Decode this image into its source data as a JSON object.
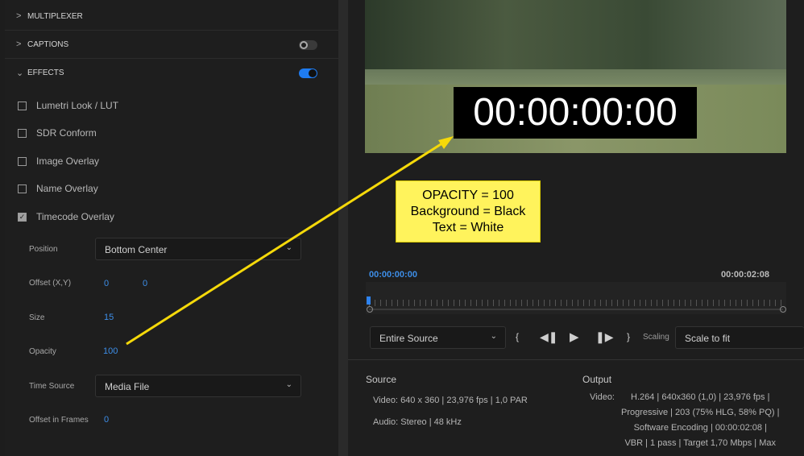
{
  "left": {
    "sections": [
      {
        "label": "MULTIPLEXER"
      },
      {
        "label": "CAPTIONS",
        "toggle": false
      },
      {
        "label": "EFFECTS",
        "toggle": true
      }
    ],
    "effects": [
      {
        "label": "Lumetri Look / LUT",
        "checked": false
      },
      {
        "label": "SDR Conform",
        "checked": false
      },
      {
        "label": "Image Overlay",
        "checked": false
      },
      {
        "label": "Name Overlay",
        "checked": false
      },
      {
        "label": "Timecode Overlay",
        "checked": true
      }
    ],
    "position": {
      "label": "Position",
      "value": "Bottom Center"
    },
    "offset": {
      "label": "Offset (X,Y)",
      "x": "0",
      "y": "0"
    },
    "size": {
      "label": "Size",
      "value": "15"
    },
    "opacity": {
      "label": "Opacity",
      "value": "100"
    },
    "time_source": {
      "label": "Time Source",
      "value": "Media File"
    },
    "offset_frames": {
      "label": "Offset in Frames",
      "value": "0"
    }
  },
  "preview": {
    "timecode": "00:00:00:00"
  },
  "annotation": {
    "lines": [
      "OPACITY = 100",
      "Background = Black",
      "Text = White"
    ],
    "color": "#fff35c",
    "arrow_color": "#f5d90a"
  },
  "timeline": {
    "current": "00:00:00:00",
    "duration": "00:00:02:08",
    "playhead_fraction": 0
  },
  "controls": {
    "range": "Entire Source",
    "scaling_label": "Scaling",
    "scaling": "Scale to fit"
  },
  "source": {
    "title": "Source",
    "video_label": "Video:",
    "video": "640 x 360 | 23,976 fps | 1,0 PAR",
    "audio_label": "Audio:",
    "audio": "Stereo | 48 kHz"
  },
  "output": {
    "title": "Output",
    "video_label": "Video:",
    "lines": [
      "H.264 | 640x360 (1,0) | 23,976 fps |",
      "Progressive | 203 (75% HLG, 58% PQ) |",
      "Software Encoding | 00:00:02:08 |",
      "VBR | 1 pass | Target 1,70 Mbps | Max"
    ]
  },
  "colors": {
    "accent": "#1e7bf0",
    "value_blue": "#3d8ee8"
  }
}
